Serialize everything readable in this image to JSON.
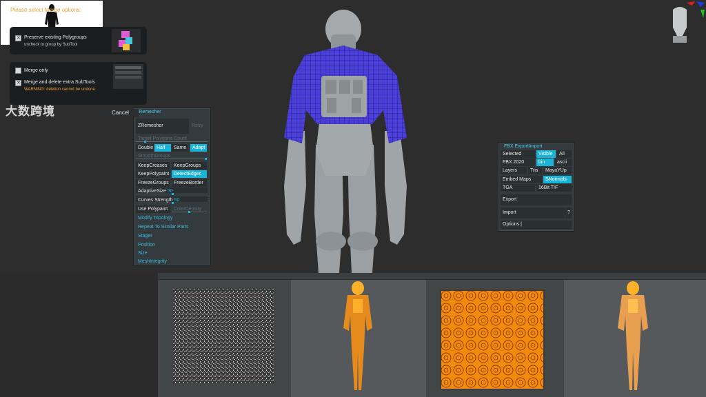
{
  "zremesher": {
    "title": "ZRemesher",
    "zremesher_btn": "ZRemesher",
    "retry": "Retry",
    "target_polygons": "Target Polygons Count",
    "double": "Double",
    "half": "Half",
    "same": "Same",
    "adapt": "Adapt",
    "smoothgroups": "SmoothGroups",
    "keepcreases": "KeepCreases",
    "keepgroups": "KeepGroups",
    "keeppolypaint": "KeepPolypaint",
    "detectedges": "DetectEdges",
    "freezegroups": "FreezeGroups",
    "freezeborder": "FreezeBorder",
    "adaptivesize": "AdaptiveSize",
    "adaptivesize_val": "50",
    "curves_strength": "Curves Strength",
    "curves_val": "50",
    "use_polypaint": "Use Polypaint",
    "colordensity": "ColorDensity",
    "modify_topology": "Modify Topology",
    "repeat_similar": "Repeat To Similar Parts",
    "stager": "Stager",
    "position": "Position",
    "size": "Size",
    "meshintegrity": "MeshIntegrity"
  },
  "fbx": {
    "title": "FBX ExportImport",
    "selected": "Selected",
    "visible": "Visible",
    "all": "All",
    "version": "FBX 2020",
    "bin": "bin",
    "ascii": "ascii",
    "layers": "Layers",
    "tris": "Tris",
    "mayayup": "MayaYUp",
    "embed_maps": "Embed Maps",
    "snormals": "SNormals",
    "tga": "TGA",
    "tif": "16Bit TIF",
    "export": "Export",
    "import": "Import",
    "help": "?",
    "options": "Options |"
  },
  "merge_dialog": {
    "title": "Please select Merge options:",
    "preserve": "Preserve existing Polygroups",
    "preserve_sub": "uncheck to group by SubTool",
    "merge_only": "Merge only",
    "merge_delete": "Merge and delete extra SubTools",
    "warning": "WARNING: deletion cannot be undone",
    "cancel": "Cancel",
    "watermark": "大数跨境"
  },
  "colors": {
    "accent": "#1ab4d8",
    "warn": "#f0a038",
    "mesh_blue": "#4a3fd8",
    "model_orange": "#ff8a00"
  }
}
